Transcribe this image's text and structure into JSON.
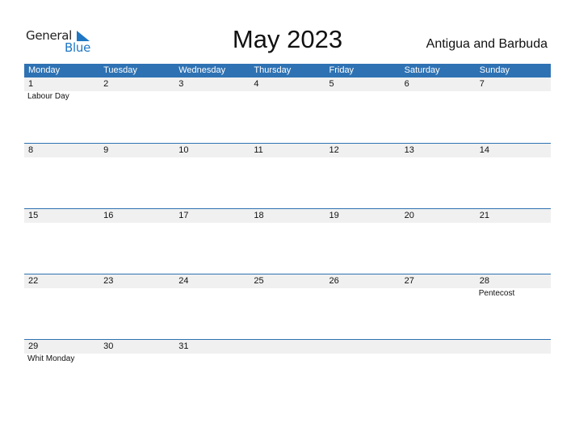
{
  "logo": {
    "line1": "General",
    "line2": "Blue"
  },
  "title": "May 2023",
  "country": "Antigua and Barbuda",
  "weekdays": [
    "Monday",
    "Tuesday",
    "Wednesday",
    "Thursday",
    "Friday",
    "Saturday",
    "Sunday"
  ],
  "weeks": [
    {
      "days": [
        "1",
        "2",
        "3",
        "4",
        "5",
        "6",
        "7"
      ],
      "holidays": [
        "Labour Day",
        "",
        "",
        "",
        "",
        "",
        ""
      ]
    },
    {
      "days": [
        "8",
        "9",
        "10",
        "11",
        "12",
        "13",
        "14"
      ],
      "holidays": [
        "",
        "",
        "",
        "",
        "",
        "",
        ""
      ]
    },
    {
      "days": [
        "15",
        "16",
        "17",
        "18",
        "19",
        "20",
        "21"
      ],
      "holidays": [
        "",
        "",
        "",
        "",
        "",
        "",
        ""
      ]
    },
    {
      "days": [
        "22",
        "23",
        "24",
        "25",
        "26",
        "27",
        "28"
      ],
      "holidays": [
        "",
        "",
        "",
        "",
        "",
        "",
        "Pentecost"
      ]
    },
    {
      "days": [
        "29",
        "30",
        "31",
        "",
        "",
        "",
        ""
      ],
      "holidays": [
        "Whit Monday",
        "",
        "",
        "",
        "",
        "",
        ""
      ]
    }
  ],
  "colors": {
    "header": "#2e72b3",
    "brand_blue": "#1f77c4",
    "day_strip": "#f0f0f0"
  }
}
